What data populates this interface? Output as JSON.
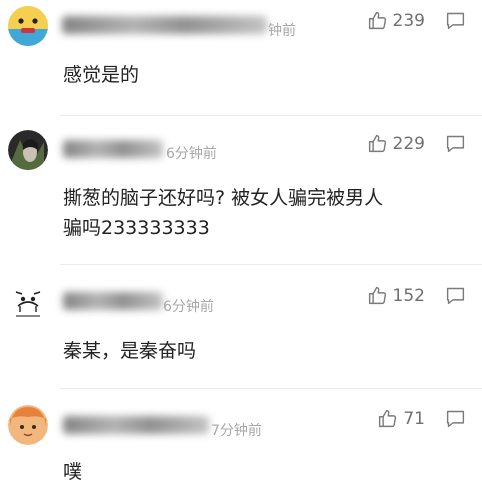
{
  "comments": [
    {
      "time": "钟前",
      "text": "感觉是的",
      "likes": "239"
    },
    {
      "time": "6分钟前",
      "text_line1": "撕葱的脑子还好吗? 被女人骗完被男人",
      "text_line2": "骗吗233333333",
      "likes": "229"
    },
    {
      "time": "6分钟前",
      "text": "秦某，是秦奋吗",
      "likes": "152"
    },
    {
      "time": "7分钟前",
      "text": "噗",
      "likes": "71"
    }
  ],
  "icons": {
    "like": "thumbs-up-icon",
    "reply": "comment-bubble-icon"
  }
}
